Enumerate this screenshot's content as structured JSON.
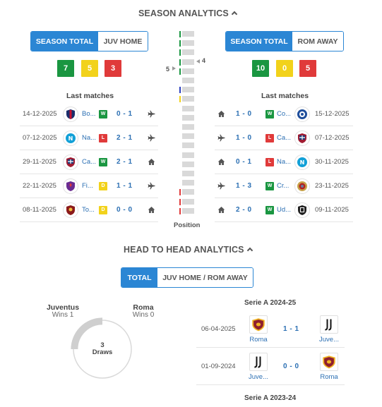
{
  "season": {
    "title": "SEASON ANALYTICS",
    "left_tabs": [
      "SEASON TOTAL",
      "JUV HOME"
    ],
    "right_tabs": [
      "SEASON TOTAL",
      "ROM AWAY"
    ],
    "left_counts": {
      "w": "7",
      "d": "5",
      "l": "3"
    },
    "right_counts": {
      "w": "10",
      "d": "0",
      "l": "5"
    },
    "last_matches_label": "Last matches",
    "position_label": "Position",
    "left_position": "5",
    "right_position": "4",
    "left_matches": [
      {
        "date": "14-12-2025",
        "team": "Bo...",
        "logo": "bologna-logo",
        "result": "W",
        "score": "0 - 1",
        "venue": "plane-icon"
      },
      {
        "date": "07-12-2025",
        "team": "Na...",
        "logo": "napoli-logo",
        "result": "L",
        "score": "2 - 1",
        "venue": "plane-icon"
      },
      {
        "date": "29-11-2025",
        "team": "Ca...",
        "logo": "cagliari-logo",
        "result": "W",
        "score": "2 - 1",
        "venue": "home-icon"
      },
      {
        "date": "22-11-2025",
        "team": "Fi...",
        "logo": "fiorentina-logo",
        "result": "D",
        "score": "1 - 1",
        "venue": "plane-icon"
      },
      {
        "date": "08-11-2025",
        "team": "To...",
        "logo": "torino-logo",
        "result": "D",
        "score": "0 - 0",
        "venue": "home-icon"
      }
    ],
    "right_matches": [
      {
        "date": "15-12-2025",
        "team": "Co...",
        "logo": "como-logo",
        "result": "W",
        "score": "1 - 0",
        "venue": "home-icon"
      },
      {
        "date": "07-12-2025",
        "team": "Ca...",
        "logo": "cagliari-logo",
        "result": "L",
        "score": "1 - 0",
        "venue": "plane-icon"
      },
      {
        "date": "30-11-2025",
        "team": "Na...",
        "logo": "napoli-logo",
        "result": "L",
        "score": "0 - 1",
        "venue": "home-icon"
      },
      {
        "date": "23-11-2025",
        "team": "Cr...",
        "logo": "cremonese-logo",
        "result": "W",
        "score": "1 - 3",
        "venue": "plane-icon"
      },
      {
        "date": "09-11-2025",
        "team": "Ud...",
        "logo": "udinese-logo",
        "result": "W",
        "score": "2 - 0",
        "venue": "home-icon"
      }
    ]
  },
  "h2h": {
    "title": "HEAD TO HEAD ANALYTICS",
    "tabs": [
      "TOTAL",
      "JUV HOME / ROM AWAY"
    ],
    "home_team": "Juventus",
    "home_wins": "Wins 1",
    "away_team": "Roma",
    "away_wins": "Wins 0",
    "draws_count": "3",
    "draws_label": "Draws",
    "competitions": [
      {
        "name": "Serie A 2024-25",
        "matches": [
          {
            "date": "06-04-2025",
            "home": "Roma",
            "home_logo": "roma-logo",
            "score": "1 - 1",
            "away": "Juve...",
            "away_logo": "juventus-logo"
          },
          {
            "date": "01-09-2024",
            "home": "Juve...",
            "home_logo": "juventus-logo",
            "score": "0 - 0",
            "away": "Roma",
            "away_logo": "roma-logo"
          }
        ]
      },
      {
        "name": "Serie A 2023-24",
        "matches": []
      }
    ]
  },
  "colors": {
    "accent": "#2b86d4",
    "win": "#1a9641",
    "draw": "#f2d21b",
    "loss": "#e03a3a",
    "link": "#2b6fb3"
  }
}
